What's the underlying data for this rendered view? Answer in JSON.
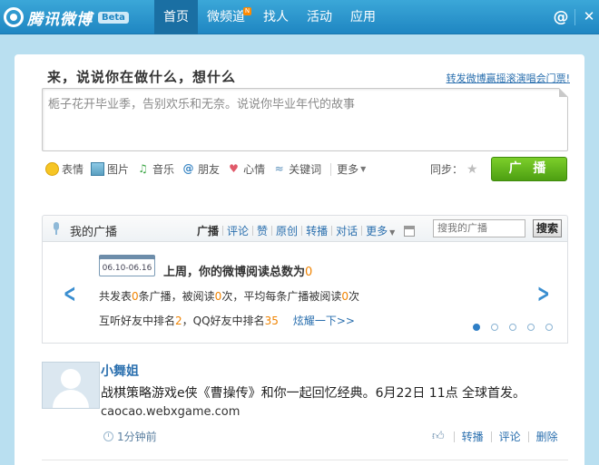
{
  "header": {
    "logo_text": "腾讯微博",
    "beta": "Beta",
    "nav": [
      {
        "label": "首页",
        "active": true
      },
      {
        "label": "微频道",
        "badge": "N"
      },
      {
        "label": "找人"
      },
      {
        "label": "活动"
      },
      {
        "label": "应用"
      }
    ],
    "at_icon": "@",
    "close_icon": "✕"
  },
  "composer": {
    "prompt": "来，说说你在做什么，想什么",
    "promo_link": "转发微博赢摇滚演唱会门票!",
    "text": "栀子花开毕业季，告别欢乐和无奈。说说你毕业年代的故事",
    "tools": [
      {
        "label": "表情",
        "icon": "smiley-icon"
      },
      {
        "label": "图片",
        "icon": "picture-icon"
      },
      {
        "label": "音乐",
        "icon": "music-icon"
      },
      {
        "label": "朋友",
        "icon": "at-icon"
      },
      {
        "label": "心情",
        "icon": "heart-icon"
      },
      {
        "label": "关键词",
        "icon": "rss-icon"
      }
    ],
    "more": "更多",
    "sync": "同步：",
    "submit": "广 播"
  },
  "my_broadcast": {
    "title": "我的广播",
    "filters": [
      "广播",
      "评论",
      "赞",
      "原创",
      "转播",
      "对话",
      "更多"
    ],
    "search_placeholder": "搜我的广播",
    "search_button": "搜索"
  },
  "weekly": {
    "date_range": "06.10-06.16",
    "title_prefix": "上周，你的微博阅读总数为",
    "total_reads": "0",
    "line1_a": "共发表",
    "line1_posts": "0",
    "line1_b": "条广播，被阅读",
    "line1_reads": "0",
    "line1_c": "次，平均每条广播被阅读",
    "line1_avg": "0",
    "line1_d": "次",
    "line2_a": "互听好友中排名",
    "line2_rank1": "2",
    "line2_b": "，QQ好友中排名",
    "line2_rank2": "35",
    "show_off": "炫耀一下>>",
    "page_count": 5,
    "active_page": 1
  },
  "post": {
    "author": "小舞姐",
    "text": "战棋策略游戏e侠《曹操传》和你一起回忆经典。6月22日 11点 全球首发。",
    "link": "caocao.webxgame.com",
    "time": "1分钟前",
    "actions": [
      "转播",
      "评论",
      "删除"
    ]
  },
  "colors": {
    "nav_bg": "#1f86c2",
    "accent_green": "#5aad16",
    "link_blue": "#2a6fae",
    "highlight_orange": "#f08300"
  }
}
